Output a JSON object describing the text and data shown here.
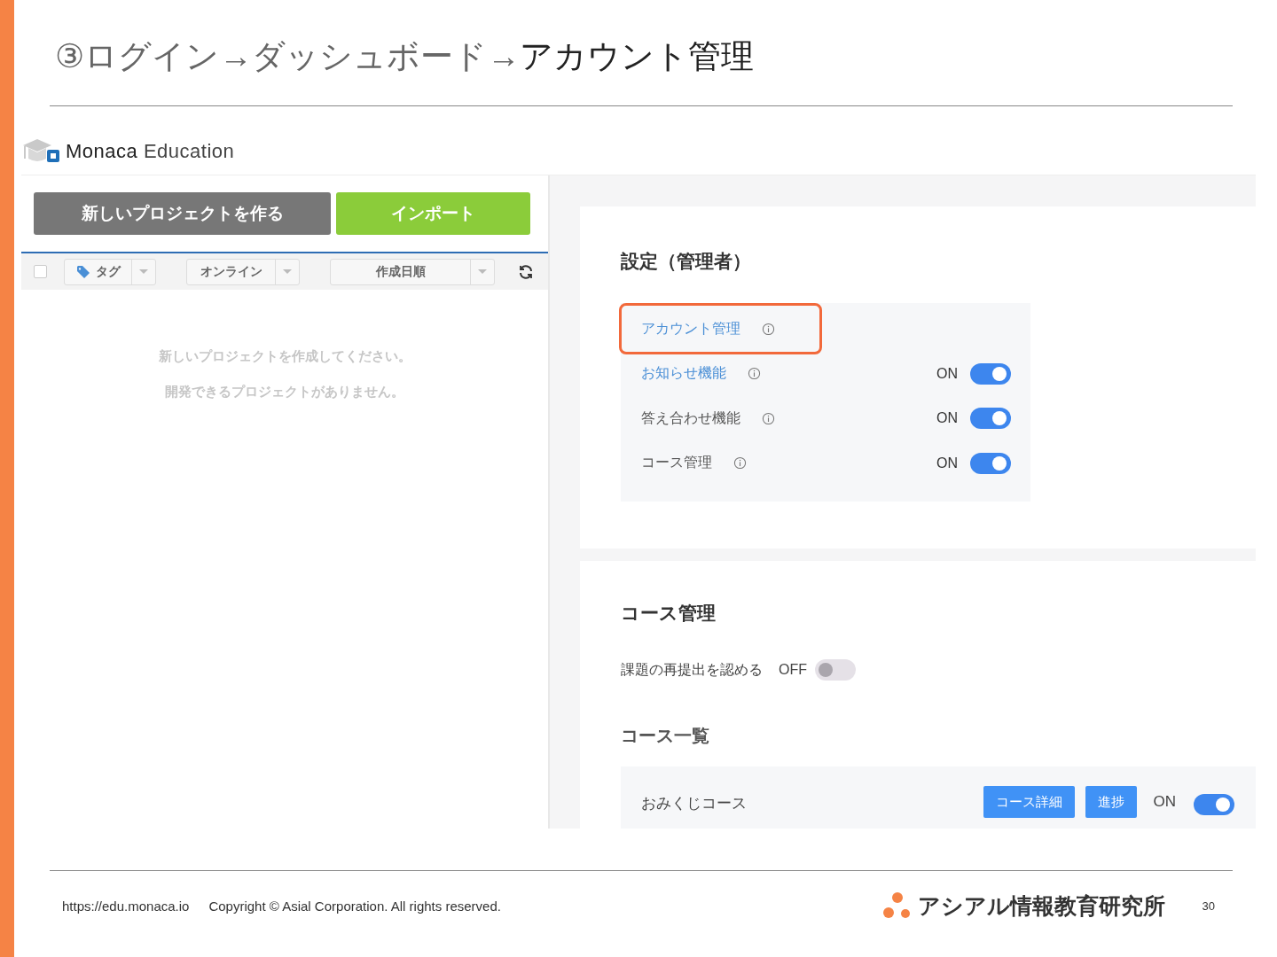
{
  "slide": {
    "title_path": "③ログイン→ダッシュボード→",
    "title_current": "アカウント管理"
  },
  "app": {
    "logo_text": "Monaca",
    "logo_sub": "Education",
    "buttons": [
      {
        "label": "新しいプロジェクトを作る",
        "kind": "create"
      },
      {
        "label": "インポート",
        "kind": "import"
      }
    ],
    "filters": {
      "select_all_checked": false,
      "dropdowns": [
        {
          "label": "タグ",
          "kind": "tag"
        },
        {
          "label": "オンライン",
          "kind": "plain"
        },
        {
          "label": "作成日順",
          "kind": "plain"
        }
      ]
    },
    "empty_messages": [
      "新しいプロジェクトを作成してください。",
      "開発できるプロジェクトがありません。"
    ],
    "settings": {
      "title": "設定（管理者）",
      "items": [
        {
          "label": "アカウント管理",
          "link": true,
          "highlighted": true
        },
        {
          "label": "お知らせ機能",
          "link": true,
          "highlighted": false,
          "state": "ON",
          "on": true
        },
        {
          "label": "答え合わせ機能",
          "link": false,
          "highlighted": false,
          "state": "ON",
          "on": true
        },
        {
          "label": "コース管理",
          "link": false,
          "highlighted": false,
          "state": "ON",
          "on": true
        }
      ]
    },
    "course_admin": {
      "title": "コース管理",
      "resubmit": {
        "label": "課題の再提出を認める",
        "state": "OFF",
        "on": false
      },
      "list_title": "コース一覧",
      "courses": [
        {
          "name": "おみくじコース",
          "buttons": [
            "コース詳細",
            "進捗"
          ],
          "state": "ON",
          "on": true
        }
      ]
    }
  },
  "footer": {
    "url": "https://edu.monaca.io",
    "copyright": "Copyright © Asial Corporation. All rights reserved.",
    "brand": "アシアル情報教育研究所",
    "page": "30"
  }
}
